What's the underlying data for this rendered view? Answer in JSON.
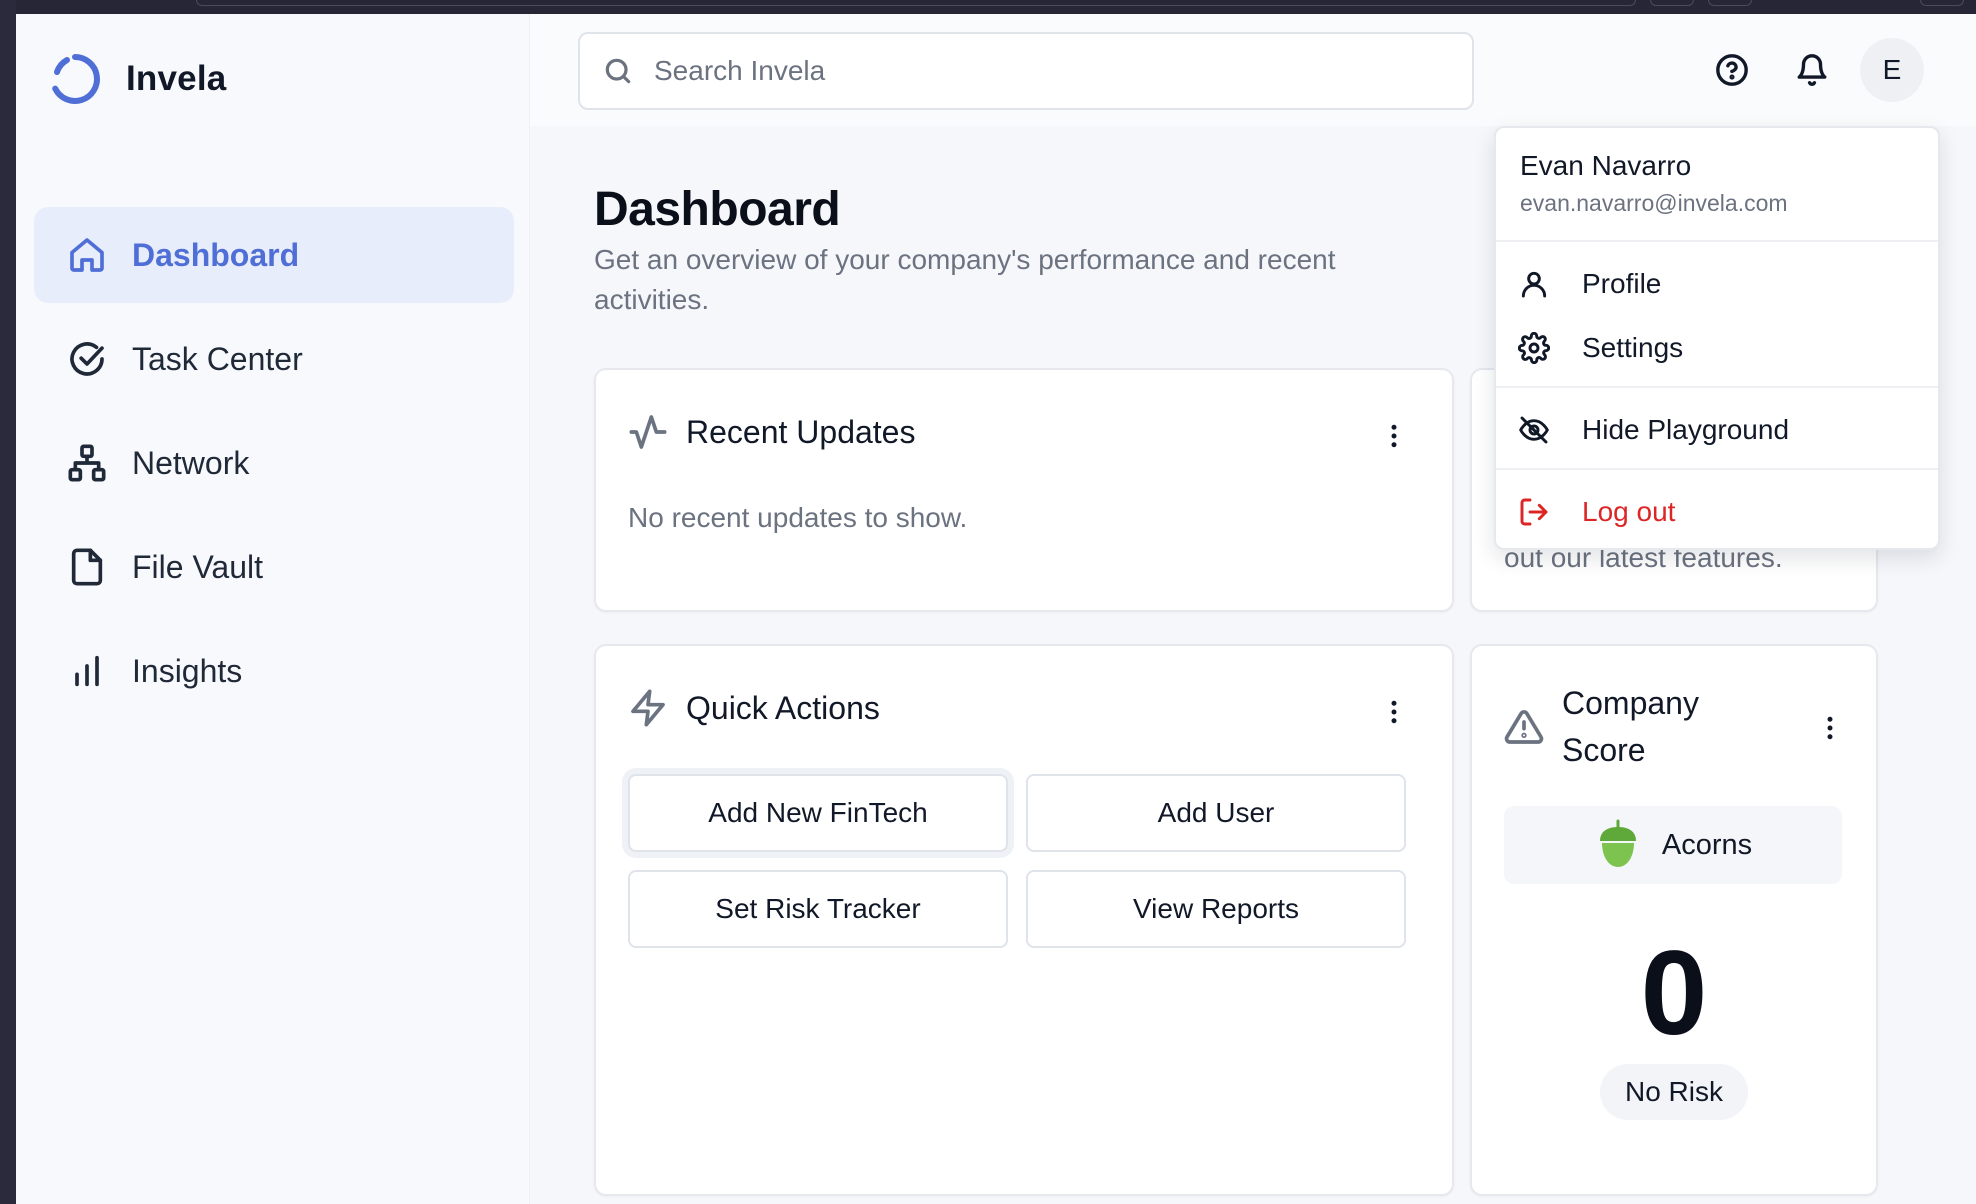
{
  "app": {
    "name": "Invela",
    "accent": "#4f6fd6",
    "danger": "#dc2626"
  },
  "sidebar": {
    "items": [
      {
        "label": "Dashboard",
        "icon": "home-icon",
        "active": true
      },
      {
        "label": "Task Center",
        "icon": "check-circle-icon",
        "active": false
      },
      {
        "label": "Network",
        "icon": "network-icon",
        "active": false
      },
      {
        "label": "File Vault",
        "icon": "file-icon",
        "active": false
      },
      {
        "label": "Insights",
        "icon": "bar-chart-icon",
        "active": false
      }
    ]
  },
  "header": {
    "search_placeholder": "Search Invela",
    "avatar_initial": "E"
  },
  "page": {
    "title": "Dashboard",
    "subtitle": "Get an overview of your company's performance and recent activities."
  },
  "cards": {
    "recent_updates": {
      "title": "Recent Updates",
      "empty_text": "No recent updates to show."
    },
    "partial_card_text": "out our latest features.",
    "quick_actions": {
      "title": "Quick Actions",
      "buttons": [
        "Add New FinTech",
        "Add User",
        "Set Risk Tracker",
        "View Reports"
      ]
    },
    "company_score": {
      "title": "Company Score",
      "company": "Acorns",
      "score": "0",
      "risk_label": "No Risk"
    }
  },
  "user_menu": {
    "name": "Evan Navarro",
    "email": "evan.navarro@invela.com",
    "items": [
      {
        "label": "Profile",
        "icon": "user-icon"
      },
      {
        "label": "Settings",
        "icon": "gear-icon"
      },
      {
        "label": "Hide Playground",
        "icon": "eye-off-icon"
      },
      {
        "label": "Log out",
        "icon": "logout-icon"
      }
    ]
  }
}
